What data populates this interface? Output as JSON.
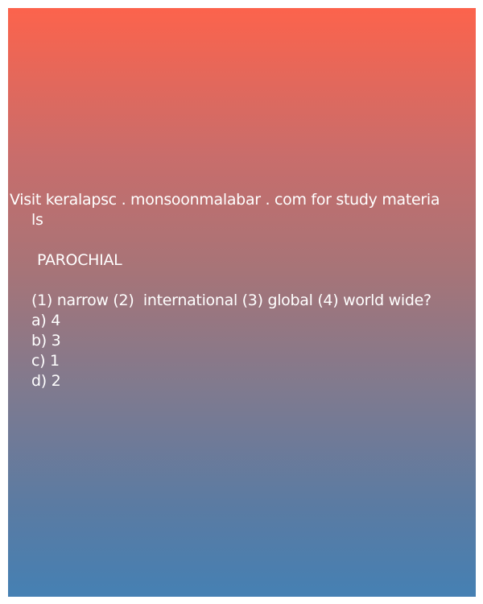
{
  "header": {
    "line1": "Visit keralapsc . monsoonmalabar . com for study materia",
    "line2": "ls"
  },
  "question": {
    "word": "PAROCHIAL",
    "prompt": "(1) narrow (2)  international (3) global (4) world wide?"
  },
  "options": [
    "a) 4",
    "b) 3",
    "c) 1",
    "d) 2"
  ],
  "colors": {
    "gradient_top": "#fc634c",
    "gradient_bottom": "#4580b3",
    "text": "#ffffff"
  }
}
